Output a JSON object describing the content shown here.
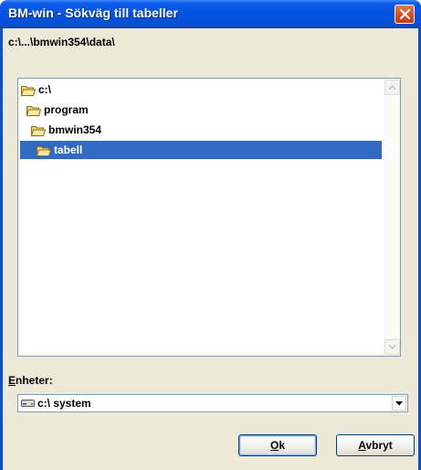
{
  "window": {
    "title": "BM-win - Sökväg till tabeller"
  },
  "path": {
    "current": "c:\\...\\bmwin354\\data\\"
  },
  "tree": {
    "items": [
      {
        "label": "c:\\",
        "level": 0,
        "selected": false,
        "icon": "folder-open-icon"
      },
      {
        "label": "program",
        "level": 1,
        "selected": false,
        "icon": "folder-open-icon"
      },
      {
        "label": "bmwin354",
        "level": 2,
        "selected": false,
        "icon": "folder-open-icon"
      },
      {
        "label": "tabell",
        "level": 3,
        "selected": true,
        "icon": "folder-open-icon"
      }
    ]
  },
  "drives": {
    "label_first": "E",
    "label_rest": "nheter:",
    "selected": "c:\\ system",
    "icon": "drive-icon"
  },
  "buttons": {
    "ok_first": "O",
    "ok_rest": "k",
    "cancel_first": "A",
    "cancel_rest": "vbryt"
  },
  "colors": {
    "titlebar": "#0054e3",
    "selection": "#316ac5",
    "dialog_bg": "#ece9d8",
    "close_button": "#d9491c"
  }
}
